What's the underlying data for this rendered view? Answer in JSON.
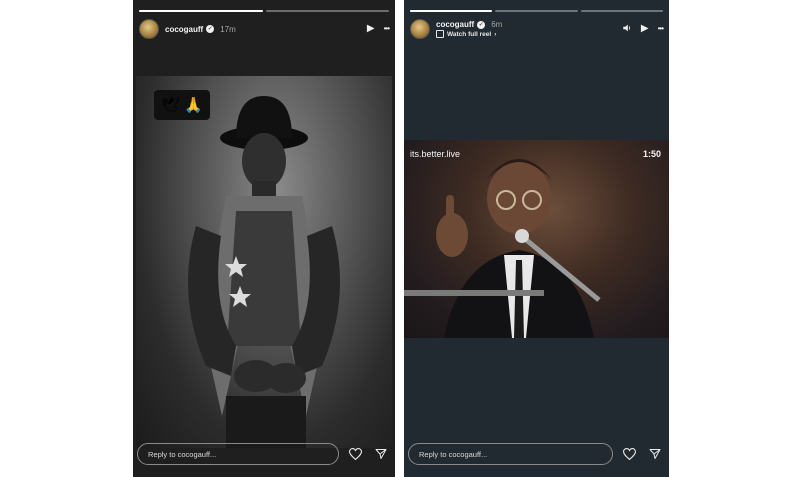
{
  "stories": [
    {
      "username": "cocogauff",
      "time": "17m",
      "progress": [
        1.0,
        0.0
      ],
      "controls": [
        "play-icon",
        "more-icon"
      ],
      "sticker": [
        "🕊",
        "🙏"
      ],
      "reply_placeholder": "Reply to cocogauff..."
    },
    {
      "username": "cocogauff",
      "time": "6m",
      "watch_label": "Watch full reel",
      "progress": [
        1.0,
        0.0,
        0.0
      ],
      "controls": [
        "volume-icon",
        "play-icon",
        "more-icon"
      ],
      "video_label": "its.better.live",
      "video_time": "1:50",
      "reply_placeholder": "Reply to cocogauff..."
    }
  ],
  "glyphs": {
    "play": "▶",
    "more": "•••",
    "verified": "✓"
  },
  "colors": {
    "story1_bg": "#1f1f1f",
    "story2_bg": "#212a30"
  }
}
